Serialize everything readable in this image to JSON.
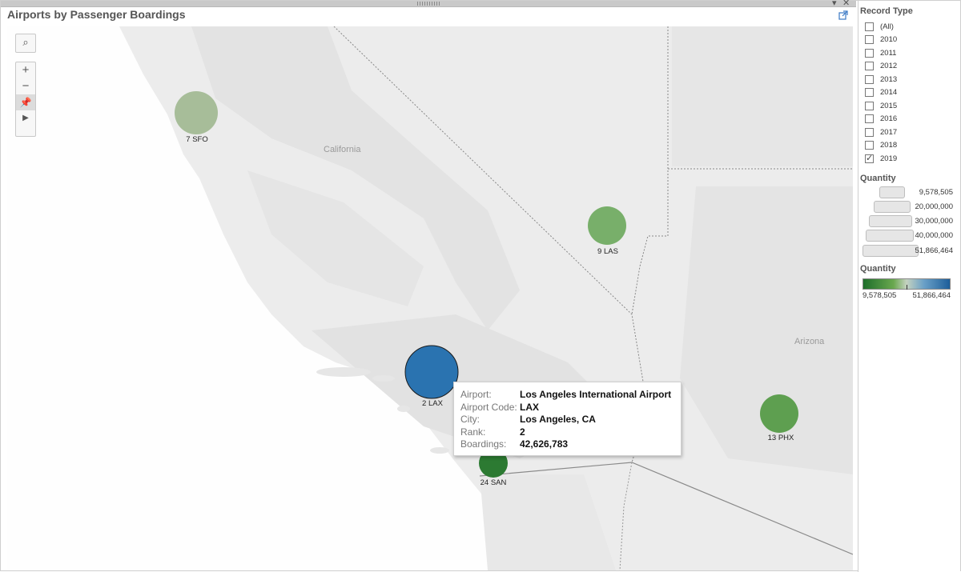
{
  "window": {
    "title": "Airports by Passenger Boardings"
  },
  "frame": {
    "dropdown_icon": "caret-down-icon",
    "close_icon": "close-icon"
  },
  "map_labels": {
    "california": "California",
    "arizona": "Arizona"
  },
  "airports": [
    {
      "label": "7 SFO",
      "rank": 7,
      "code": "SFO",
      "color": "#a7bd99"
    },
    {
      "label": "9 LAS",
      "rank": 9,
      "code": "LAS",
      "color": "#78af6a"
    },
    {
      "label": "2 LAX",
      "rank": 2,
      "code": "LAX",
      "color": "#2a73b0"
    },
    {
      "label": "24 SAN",
      "rank": 24,
      "code": "SAN",
      "color": "#2c7a32"
    },
    {
      "label": "13 PHX",
      "rank": 13,
      "code": "PHX",
      "color": "#5e9f50"
    }
  ],
  "tooltip": {
    "rows": [
      {
        "key": "Airport:",
        "value": "Los Angeles International Airport"
      },
      {
        "key": "Airport Code:",
        "value": "LAX"
      },
      {
        "key": "City:",
        "value": "Los Angeles, CA"
      },
      {
        "key": "Rank:",
        "value": "2"
      },
      {
        "key": "Boardings:",
        "value": "42,626,783"
      }
    ]
  },
  "toolbar": {
    "search_icon": "magnifier-icon",
    "zoom_in": "+",
    "zoom_out": "−",
    "pin_icon": "pin-icon",
    "expand_icon": "play-icon"
  },
  "filters": {
    "title": "Record Type",
    "options": [
      {
        "label": "(All)",
        "checked": false
      },
      {
        "label": "2010",
        "checked": false
      },
      {
        "label": "2011",
        "checked": false
      },
      {
        "label": "2012",
        "checked": false
      },
      {
        "label": "2013",
        "checked": false
      },
      {
        "label": "2014",
        "checked": false
      },
      {
        "label": "2015",
        "checked": false
      },
      {
        "label": "2016",
        "checked": false
      },
      {
        "label": "2017",
        "checked": false
      },
      {
        "label": "2018",
        "checked": false
      },
      {
        "label": "2019",
        "checked": true
      }
    ]
  },
  "size_legend": {
    "title": "Quantity",
    "items": [
      "9,578,505",
      "20,000,000",
      "30,000,000",
      "40,000,000",
      "51,866,464"
    ]
  },
  "color_legend": {
    "title": "Quantity",
    "min": "9,578,505",
    "max": "51,866,464",
    "colors": [
      "#1e6e2b",
      "#6aa84f",
      "#c5d2c0",
      "#6aa0c7",
      "#1d5e9a"
    ]
  }
}
